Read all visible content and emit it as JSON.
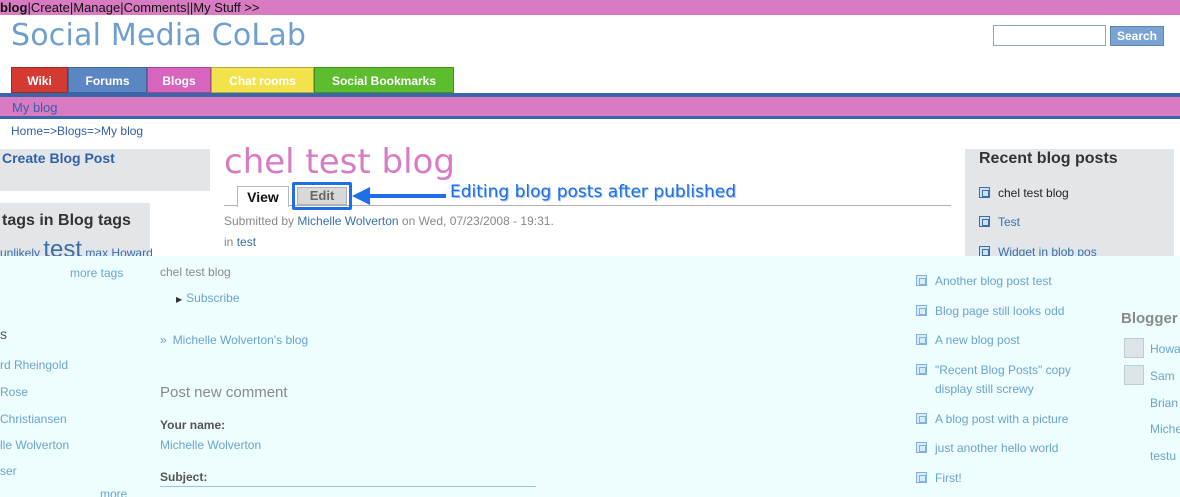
{
  "admin_bar": {
    "brand": "blog",
    "items": [
      "Create",
      "Manage",
      "Comments",
      "",
      "My Stuff >>"
    ]
  },
  "site": {
    "title": "Social Media CoLab"
  },
  "search": {
    "button": "Search",
    "value": ""
  },
  "nav": {
    "tabs": [
      {
        "label": "Wiki",
        "color": "#d43a32"
      },
      {
        "label": "Forums",
        "color": "#5b86c4"
      },
      {
        "label": "Blogs",
        "color": "#d764bd"
      },
      {
        "label": "Chat rooms",
        "color": "#f2e24c"
      },
      {
        "label": "Social Bookmarks",
        "color": "#5ebd2f"
      }
    ]
  },
  "section": {
    "label": "My blog"
  },
  "breadcrumb": "Home=>Blogs=>My blog",
  "left": {
    "create_post": "Create Blog Post",
    "tags_title": "tags in Blog tags",
    "tags": [
      "unlikely",
      "test",
      "max",
      "Howard"
    ],
    "more_tags": "more tags",
    "bloggers_heading": "s",
    "bloggers": [
      "rd Rheingold",
      "Rose",
      "Christiansen",
      "lle Wolverton",
      "ser"
    ],
    "more": "more"
  },
  "post": {
    "title": "chel test blog",
    "tab_view": "View",
    "tab_edit": "Edit",
    "annotation": "Editing blog posts after published",
    "submitted_prefix": "Submitted by",
    "author": "Michelle Wolverton",
    "submitted_date": "on Wed, 07/23/2008 - 19:31.",
    "in_label": "in",
    "in_tag": "test"
  },
  "recent": {
    "title": "Recent blog posts",
    "items": [
      "chel test blog",
      "Test",
      "Widget in blob pos"
    ]
  },
  "overlay": {
    "blog_title": "chel test blog",
    "subscribe": "Subscribe",
    "user_blog": "Michelle Wolverton's blog",
    "post_comment": "Post new comment",
    "your_name_label": "Your name:",
    "your_name_value": "Michelle Wolverton",
    "subject_label": "Subject:",
    "more_posts": [
      "Another blog post test",
      "Blog page still looks odd",
      "A new blog post",
      "\"Recent Blog Posts\" copy",
      "display still screwy",
      "A blog post with a picture",
      "just another hello world",
      "First!"
    ],
    "bloggers_title": "Blogger",
    "bloggers": [
      "Howa",
      "Sam",
      "Brian",
      "Miche",
      "testu"
    ]
  }
}
